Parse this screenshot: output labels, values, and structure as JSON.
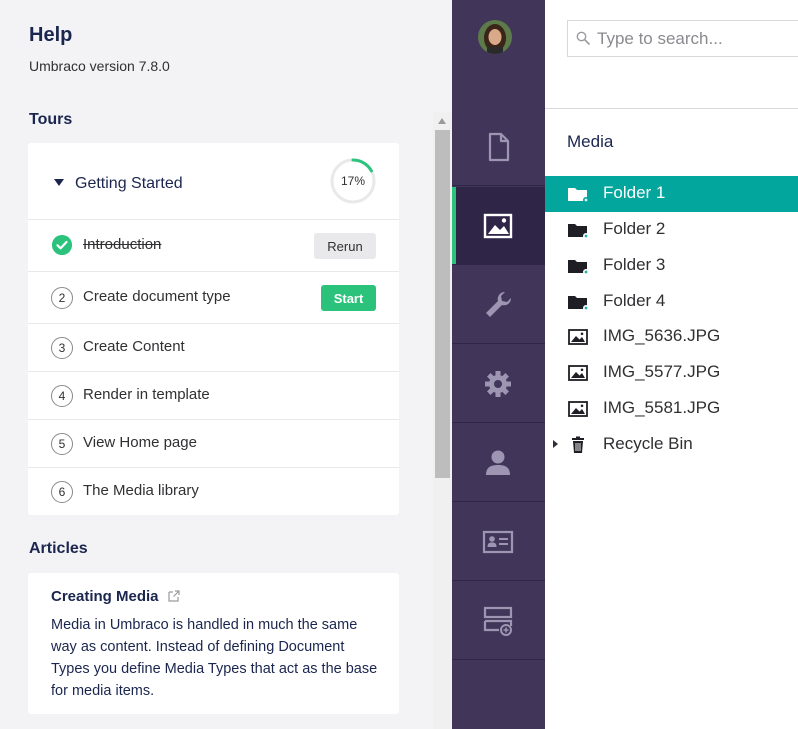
{
  "help": {
    "title": "Help",
    "version": "Umbraco version 7.8.0",
    "tours_heading": "Tours",
    "tour_group": {
      "title": "Getting Started",
      "progress_label": "17%",
      "progress": 0.17,
      "steps": [
        {
          "number": "",
          "label": "Introduction",
          "button": "Rerun"
        },
        {
          "number": "2",
          "label": "Create document type",
          "button": "Start"
        },
        {
          "number": "3",
          "label": "Create Content"
        },
        {
          "number": "4",
          "label": "Render in template"
        },
        {
          "number": "5",
          "label": "View Home page"
        },
        {
          "number": "6",
          "label": "The Media library"
        }
      ]
    },
    "articles_heading": "Articles",
    "article": {
      "title": "Creating Media",
      "body": "Media in Umbraco is handled in much the same way as content. Instead of defining Document Types you define Media Types that act as the base for media items."
    }
  },
  "sections": [
    {
      "name": "content",
      "icon": "document-icon"
    },
    {
      "name": "media",
      "icon": "image-icon",
      "active": true
    },
    {
      "name": "settings",
      "icon": "wrench-icon"
    },
    {
      "name": "developer",
      "icon": "gear-icon"
    },
    {
      "name": "users",
      "icon": "user-icon"
    },
    {
      "name": "members",
      "icon": "id-card-icon"
    },
    {
      "name": "forms",
      "icon": "form-add-icon"
    }
  ],
  "tree": {
    "search_placeholder": "Type to search...",
    "root_label": "Media",
    "items": [
      {
        "label": "Folder 1",
        "icon": "folder-icon",
        "selected": true
      },
      {
        "label": "Folder 2",
        "icon": "folder-icon"
      },
      {
        "label": "Folder 3",
        "icon": "folder-icon"
      },
      {
        "label": "Folder 4",
        "icon": "folder-icon"
      },
      {
        "label": "IMG_5636.JPG",
        "icon": "image-file-icon"
      },
      {
        "label": "IMG_5577.JPG",
        "icon": "image-file-icon"
      },
      {
        "label": "IMG_5581.JPG",
        "icon": "image-file-icon"
      },
      {
        "label": "Recycle Bin",
        "icon": "trash-icon"
      }
    ]
  },
  "colors": {
    "accent_green": "#2bc37c",
    "sidebar_purple": "#413659",
    "selected_teal": "#02a69d",
    "heading_navy": "#1b264f"
  }
}
